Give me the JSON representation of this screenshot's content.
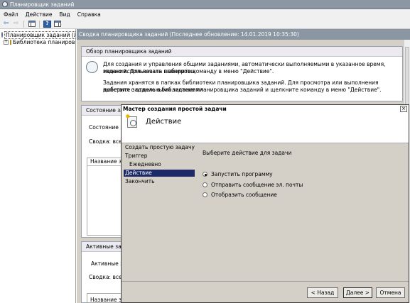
{
  "window": {
    "title": "Планировщик заданий"
  },
  "menu": [
    "Файл",
    "Действие",
    "Вид",
    "Справка"
  ],
  "toolbar": {
    "back_glyph": "⇦",
    "forward_glyph": "⇨",
    "help_glyph": "?"
  },
  "tree": {
    "root": "Планировщик заданий (Локал",
    "library": "Библиотека планировщ",
    "expand_glyph": "+"
  },
  "pane": {
    "header": "Сводка планировщика заданий (Последнее обновление: 14.01.2019 10:35:30)",
    "overview_title": "Обзор планировщика заданий",
    "overview_text_1a": "Для создания и управления общими заданиями, автоматически выполняемыми в указанное время, можно использовать планировщ",
    "overview_text_1b": "заданий. Для начала выберите команду в меню \"Действие\".",
    "overview_text_2a": "Задания хранятся в папках библиотеки планировщика заданий. Для просмотра или выполнения действия с отдельными заданиями",
    "overview_text_2b": "выберите задание в библиотеке планировщика заданий и щелкните команду в меню \"Действие\".",
    "status_title": "Состояние зада",
    "status_label": "Состояние зада",
    "summary_label": "Сводка: всего",
    "col_name": "Название зада",
    "active_title": "Активные задач",
    "active_label": "Активные зада",
    "active_summary": "Сводка: всего",
    "active_col_name": "Название зада"
  },
  "dialog": {
    "title": "Мастер создания простой задачи",
    "close_glyph": "×",
    "heading": "Действие",
    "spark_glyph": "✸",
    "steps": [
      "Создать простую задачу",
      "Триггер",
      "Ежедневно",
      "Действие",
      "Закончить"
    ],
    "prompt": "Выберите действие для задачи",
    "options": [
      "Запустить программу",
      "Отправить сообщение эл. почты",
      "Отобразить сообщение"
    ],
    "selected_option": 0,
    "buttons": {
      "back": "< Назад",
      "next": "Далее >",
      "cancel": "Отмена"
    }
  }
}
